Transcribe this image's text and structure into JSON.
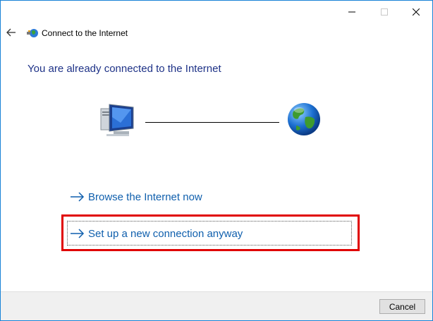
{
  "window": {
    "title": "Connect to the Internet",
    "controls": {
      "minimize": "minimize-icon",
      "maximize": "maximize-icon",
      "close": "close-icon"
    }
  },
  "header": {
    "back_icon": "back-arrow-icon",
    "app_icon": "network-globe-icon"
  },
  "main": {
    "headline": "You are already connected to the Internet",
    "illustration": {
      "left": "computer-icon",
      "right": "globe-icon"
    },
    "links": [
      {
        "label": "Browse the Internet now",
        "icon": "arrow-right-icon"
      },
      {
        "label": "Set up a new connection anyway",
        "icon": "arrow-right-icon",
        "highlighted": true
      }
    ]
  },
  "footer": {
    "cancel_label": "Cancel"
  },
  "colors": {
    "window_border": "#1883d7",
    "headline": "#1e3287",
    "link": "#0f5fad",
    "highlight": "#e00000",
    "footer_bg": "#f0f0f0"
  }
}
